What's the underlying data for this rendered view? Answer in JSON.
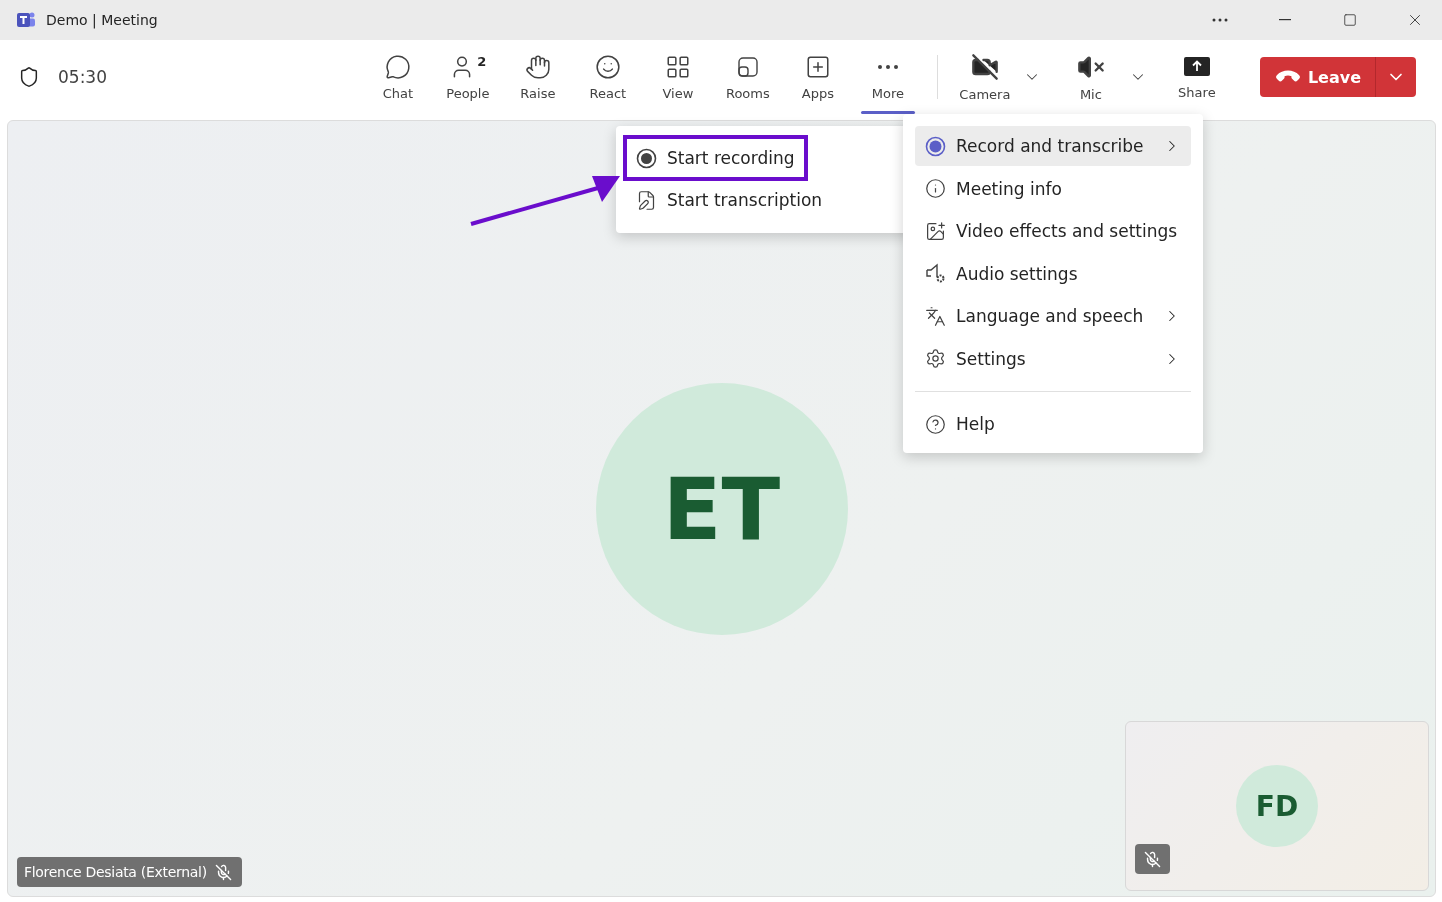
{
  "window": {
    "title": "Demo | Meeting"
  },
  "meeting": {
    "timer": "05:30"
  },
  "toolbar": {
    "items": [
      {
        "kind": "chat",
        "label": "Chat",
        "selected": false
      },
      {
        "kind": "people",
        "label": "People",
        "badge": "2",
        "selected": false
      },
      {
        "kind": "raise",
        "label": "Raise",
        "selected": false
      },
      {
        "kind": "react",
        "label": "React",
        "selected": false
      },
      {
        "kind": "view",
        "label": "View",
        "selected": false
      },
      {
        "kind": "rooms",
        "label": "Rooms",
        "selected": false
      },
      {
        "kind": "apps",
        "label": "Apps",
        "selected": false
      },
      {
        "kind": "more",
        "label": "More",
        "selected": true
      }
    ],
    "devices": [
      {
        "kind": "camera",
        "label": "Camera",
        "on": false
      },
      {
        "kind": "mic",
        "label": "Mic",
        "on": false
      }
    ],
    "share": {
      "label": "Share"
    },
    "leave": {
      "label": "Leave"
    }
  },
  "more_menu": {
    "items": [
      {
        "kind": "record",
        "label": "Record and transcribe",
        "submenu": true,
        "selected": true
      },
      {
        "kind": "info",
        "label": "Meeting info",
        "submenu": false,
        "selected": false
      },
      {
        "kind": "video",
        "label": "Video effects and settings",
        "submenu": false,
        "selected": false
      },
      {
        "kind": "audio",
        "label": "Audio settings",
        "submenu": false,
        "selected": false
      },
      {
        "kind": "language",
        "label": "Language and speech",
        "submenu": true,
        "selected": false
      },
      {
        "kind": "settings",
        "label": "Settings",
        "submenu": true,
        "selected": false
      }
    ],
    "help": {
      "label": "Help"
    }
  },
  "record_submenu": {
    "items": [
      {
        "kind": "record",
        "label": "Start recording",
        "highlighted": true
      },
      {
        "kind": "transcription",
        "label": "Start transcription",
        "highlighted": false
      }
    ]
  },
  "stage": {
    "main": {
      "initials": "ET"
    },
    "name_tag": {
      "name": "Florence Desiata (External)",
      "muted": true
    },
    "self_view": {
      "initials": "FD",
      "muted": true
    }
  }
}
